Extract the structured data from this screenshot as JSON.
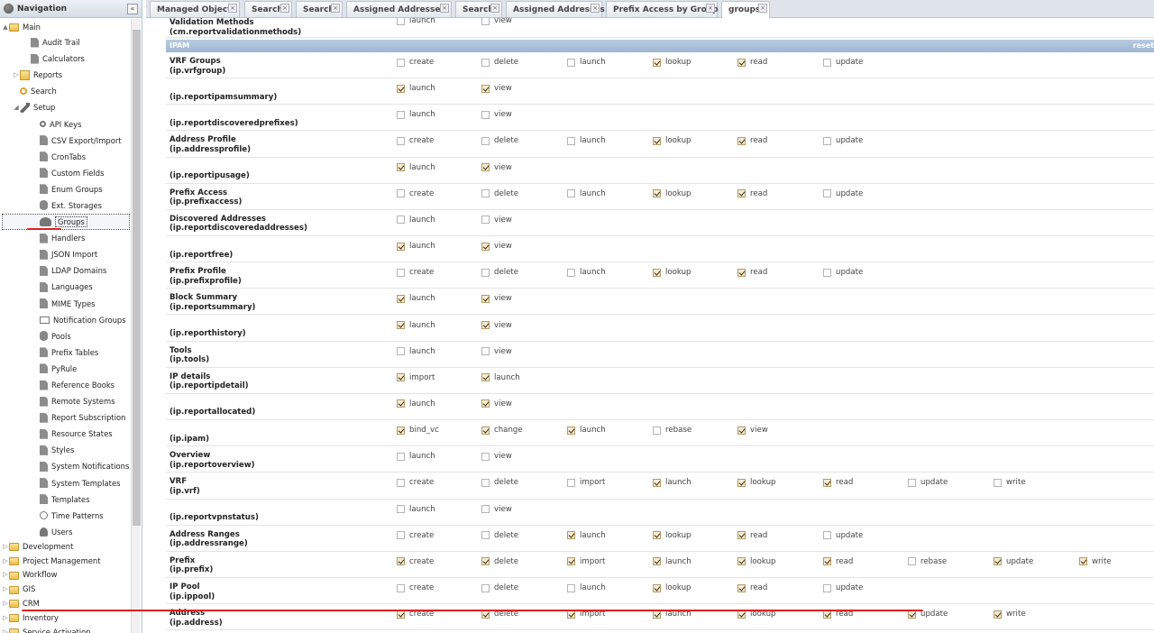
{
  "navigation": {
    "title": "Navigation",
    "collapse_label": "«",
    "items": [
      {
        "label": "Main",
        "icon": "folder-icon",
        "level": 0,
        "top": true,
        "toggle": "▲"
      },
      {
        "label": "Audit Trail",
        "icon": "page-icon",
        "level": 2
      },
      {
        "label": "Calculators",
        "icon": "page-icon",
        "level": 2
      },
      {
        "label": "Reports",
        "icon": "reports-folder-icon",
        "level": 1,
        "toggle": "▷"
      },
      {
        "label": "Search",
        "icon": "search-icon",
        "level": 1
      },
      {
        "label": "Setup",
        "icon": "wrench-icon",
        "level": 1,
        "toggle": "◢"
      },
      {
        "label": "API Keys",
        "icon": "key-icon",
        "level": 3
      },
      {
        "label": "CSV Export/Import",
        "icon": "page-icon",
        "level": 3
      },
      {
        "label": "CronTabs",
        "icon": "page-icon",
        "level": 3
      },
      {
        "label": "Custom Fields",
        "icon": "page-icon",
        "level": 3
      },
      {
        "label": "Enum Groups",
        "icon": "page-icon",
        "level": 3
      },
      {
        "label": "Ext. Storages",
        "icon": "database-icon",
        "level": 3
      },
      {
        "label": "Groups",
        "icon": "people-icon",
        "level": 3,
        "selected": true
      },
      {
        "label": "Handlers",
        "icon": "page-icon",
        "level": 3
      },
      {
        "label": "JSON Import",
        "icon": "page-icon",
        "level": 3
      },
      {
        "label": "LDAP Domains",
        "icon": "page-icon",
        "level": 3
      },
      {
        "label": "Languages",
        "icon": "page-icon",
        "level": 3
      },
      {
        "label": "MIME Types",
        "icon": "page-icon",
        "level": 3
      },
      {
        "label": "Notification Groups",
        "icon": "mail-icon",
        "level": 3
      },
      {
        "label": "Pools",
        "icon": "database-icon",
        "level": 3
      },
      {
        "label": "Prefix Tables",
        "icon": "page-icon",
        "level": 3
      },
      {
        "label": "PyRule",
        "icon": "page-icon",
        "level": 3
      },
      {
        "label": "Reference Books",
        "icon": "page-icon",
        "level": 3
      },
      {
        "label": "Remote Systems",
        "icon": "page-icon",
        "level": 3
      },
      {
        "label": "Report Subscription",
        "icon": "page-icon",
        "level": 3
      },
      {
        "label": "Resource States",
        "icon": "page-icon",
        "level": 3
      },
      {
        "label": "Styles",
        "icon": "page-icon",
        "level": 3
      },
      {
        "label": "System Notifications",
        "icon": "page-icon",
        "level": 3
      },
      {
        "label": "System Templates",
        "icon": "page-icon",
        "level": 3
      },
      {
        "label": "Templates",
        "icon": "page-icon",
        "level": 3
      },
      {
        "label": "Time Patterns",
        "icon": "clock-icon",
        "level": 3
      },
      {
        "label": "Users",
        "icon": "user-icon",
        "level": 3
      },
      {
        "label": "Development",
        "icon": "folder-icon",
        "level": 0,
        "top": true,
        "toggle": "▷"
      },
      {
        "label": "Project Management",
        "icon": "folder-icon",
        "level": 0,
        "top": true,
        "toggle": "▷"
      },
      {
        "label": "Workflow",
        "icon": "folder-icon",
        "level": 0,
        "top": true,
        "toggle": "▷"
      },
      {
        "label": "GIS",
        "icon": "folder-icon",
        "level": 0,
        "top": true,
        "toggle": "▷"
      },
      {
        "label": "CRM",
        "icon": "folder-icon",
        "level": 0,
        "top": true,
        "toggle": "▷"
      },
      {
        "label": "Inventory",
        "icon": "folder-icon",
        "level": 0,
        "top": true,
        "toggle": "▷"
      },
      {
        "label": "Service Activation",
        "icon": "folder-icon",
        "level": 0,
        "top": true,
        "toggle": "▷"
      }
    ]
  },
  "tabs": [
    {
      "label": "Managed Objects",
      "close": "×"
    },
    {
      "label": "Search",
      "close": "×"
    },
    {
      "label": "Search",
      "close": "×"
    },
    {
      "label": "Assigned Addresses",
      "close": "×"
    },
    {
      "label": "Search",
      "close": "×"
    },
    {
      "label": "Assigned Addresses",
      "close": "×"
    },
    {
      "label": "Prefix Access by Group",
      "close": "×"
    },
    {
      "label": "groups",
      "close": "×",
      "active": true
    }
  ],
  "section": {
    "title": "IPAM",
    "reset_label": "reset"
  },
  "permission_rows": [
    {
      "name": "Validation Methods",
      "code": "(cm.reportvalidationmethods)",
      "perms": [
        {
          "label": "launch",
          "checked": false
        },
        {
          "label": "view",
          "checked": false
        }
      ]
    },
    {
      "name": "VRF Groups",
      "code": "(ip.vrfgroup)",
      "perms": [
        {
          "label": "create",
          "checked": false
        },
        {
          "label": "delete",
          "checked": false
        },
        {
          "label": "launch",
          "checked": false
        },
        {
          "label": "lookup",
          "checked": true
        },
        {
          "label": "read",
          "checked": true
        },
        {
          "label": "update",
          "checked": false
        }
      ]
    },
    {
      "name": "",
      "code": "(ip.reportipamsummary)",
      "perms": [
        {
          "label": "launch",
          "checked": true
        },
        {
          "label": "view",
          "checked": true
        }
      ]
    },
    {
      "name": "",
      "code": "(ip.reportdiscoveredprefixes)",
      "perms": [
        {
          "label": "launch",
          "checked": false
        },
        {
          "label": "view",
          "checked": false
        }
      ]
    },
    {
      "name": "Address Profile",
      "code": "(ip.addressprofile)",
      "perms": [
        {
          "label": "create",
          "checked": false
        },
        {
          "label": "delete",
          "checked": false
        },
        {
          "label": "launch",
          "checked": false
        },
        {
          "label": "lookup",
          "checked": true
        },
        {
          "label": "read",
          "checked": true
        },
        {
          "label": "update",
          "checked": false
        }
      ]
    },
    {
      "name": "",
      "code": "(ip.reportipusage)",
      "perms": [
        {
          "label": "launch",
          "checked": true
        },
        {
          "label": "view",
          "checked": true
        }
      ]
    },
    {
      "name": "Prefix Access",
      "code": "(ip.prefixaccess)",
      "perms": [
        {
          "label": "create",
          "checked": false
        },
        {
          "label": "delete",
          "checked": false
        },
        {
          "label": "launch",
          "checked": false
        },
        {
          "label": "lookup",
          "checked": true
        },
        {
          "label": "read",
          "checked": true
        },
        {
          "label": "update",
          "checked": false
        }
      ]
    },
    {
      "name": "Discovered Addresses",
      "code": "(ip.reportdiscoveredaddresses)",
      "perms": [
        {
          "label": "launch",
          "checked": false
        },
        {
          "label": "view",
          "checked": false
        }
      ]
    },
    {
      "name": "",
      "code": "(ip.reportfree)",
      "perms": [
        {
          "label": "launch",
          "checked": true
        },
        {
          "label": "view",
          "checked": true
        }
      ]
    },
    {
      "name": "Prefix Profile",
      "code": "(ip.prefixprofile)",
      "perms": [
        {
          "label": "create",
          "checked": false
        },
        {
          "label": "delete",
          "checked": false
        },
        {
          "label": "launch",
          "checked": false
        },
        {
          "label": "lookup",
          "checked": true
        },
        {
          "label": "read",
          "checked": true
        },
        {
          "label": "update",
          "checked": false
        }
      ]
    },
    {
      "name": "Block Summary",
      "code": "(ip.reportsummary)",
      "perms": [
        {
          "label": "launch",
          "checked": true
        },
        {
          "label": "view",
          "checked": true
        }
      ]
    },
    {
      "name": "",
      "code": "(ip.reporthistory)",
      "perms": [
        {
          "label": "launch",
          "checked": true
        },
        {
          "label": "view",
          "checked": true
        }
      ]
    },
    {
      "name": "Tools",
      "code": "(ip.tools)",
      "perms": [
        {
          "label": "launch",
          "checked": false
        },
        {
          "label": "view",
          "checked": false
        }
      ]
    },
    {
      "name": "IP details",
      "code": "(ip.reportipdetail)",
      "perms": [
        {
          "label": "import",
          "checked": true
        },
        {
          "label": "launch",
          "checked": true
        }
      ]
    },
    {
      "name": "",
      "code": "(ip.reportallocated)",
      "perms": [
        {
          "label": "launch",
          "checked": true
        },
        {
          "label": "view",
          "checked": true
        }
      ]
    },
    {
      "name": "",
      "code": "(ip.ipam)",
      "perms": [
        {
          "label": "bind_vc",
          "checked": true
        },
        {
          "label": "change",
          "checked": true
        },
        {
          "label": "launch",
          "checked": true
        },
        {
          "label": "rebase",
          "checked": false
        },
        {
          "label": "view",
          "checked": true
        }
      ]
    },
    {
      "name": "Overview",
      "code": "(ip.reportoverview)",
      "perms": [
        {
          "label": "launch",
          "checked": false
        },
        {
          "label": "view",
          "checked": false
        }
      ]
    },
    {
      "name": "VRF",
      "code": "(ip.vrf)",
      "perms": [
        {
          "label": "create",
          "checked": false
        },
        {
          "label": "delete",
          "checked": false
        },
        {
          "label": "import",
          "checked": false
        },
        {
          "label": "launch",
          "checked": true
        },
        {
          "label": "lookup",
          "checked": true
        },
        {
          "label": "read",
          "checked": true
        },
        {
          "label": "update",
          "checked": false
        },
        {
          "label": "write",
          "checked": false
        }
      ]
    },
    {
      "name": "",
      "code": "(ip.reportvpnstatus)",
      "perms": [
        {
          "label": "launch",
          "checked": false
        },
        {
          "label": "view",
          "checked": false
        }
      ]
    },
    {
      "name": "Address Ranges",
      "code": "(ip.addressrange)",
      "perms": [
        {
          "label": "create",
          "checked": false
        },
        {
          "label": "delete",
          "checked": false
        },
        {
          "label": "launch",
          "checked": true
        },
        {
          "label": "lookup",
          "checked": true
        },
        {
          "label": "read",
          "checked": true
        },
        {
          "label": "update",
          "checked": false
        }
      ]
    },
    {
      "name": "Prefix",
      "code": "(ip.prefix)",
      "perms": [
        {
          "label": "create",
          "checked": true
        },
        {
          "label": "delete",
          "checked": true
        },
        {
          "label": "import",
          "checked": true
        },
        {
          "label": "launch",
          "checked": true
        },
        {
          "label": "lookup",
          "checked": true
        },
        {
          "label": "read",
          "checked": true
        },
        {
          "label": "rebase",
          "checked": false
        },
        {
          "label": "update",
          "checked": true
        },
        {
          "label": "write",
          "checked": true
        }
      ]
    },
    {
      "name": "IP Pool",
      "code": "(ip.ippool)",
      "perms": [
        {
          "label": "create",
          "checked": false
        },
        {
          "label": "delete",
          "checked": false
        },
        {
          "label": "launch",
          "checked": false
        },
        {
          "label": "lookup",
          "checked": true
        },
        {
          "label": "read",
          "checked": true
        },
        {
          "label": "update",
          "checked": false
        }
      ]
    },
    {
      "name": "Address",
      "code": "(ip.address)",
      "perms": [
        {
          "label": "create",
          "checked": true
        },
        {
          "label": "delete",
          "checked": true
        },
        {
          "label": "import",
          "checked": true
        },
        {
          "label": "launch",
          "checked": true
        },
        {
          "label": "lookup",
          "checked": true
        },
        {
          "label": "read",
          "checked": true
        },
        {
          "label": "update",
          "checked": true
        },
        {
          "label": "write",
          "checked": true
        }
      ]
    }
  ]
}
